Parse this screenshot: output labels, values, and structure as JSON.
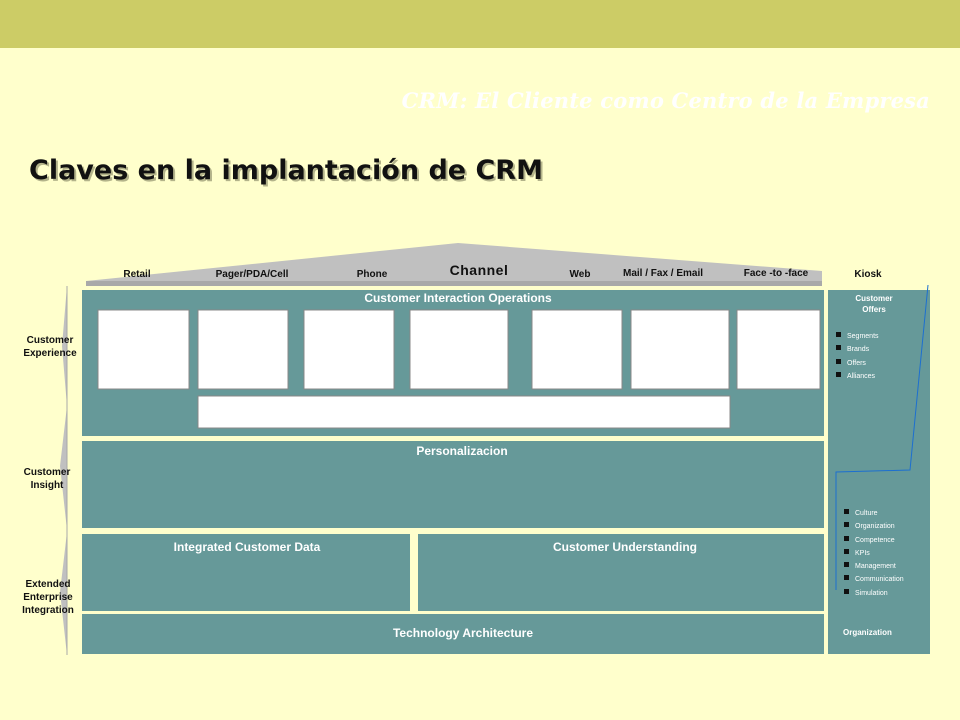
{
  "header": {
    "subtitle": "CRM: El Cliente como Centro de la Empresa",
    "title": "Claves en la implantación de CRM"
  },
  "channel": {
    "title": "Channel",
    "items": [
      "Retail",
      "Pager/PDA/Cell",
      "Phone",
      "Web",
      "Mail / Fax / Email",
      "Face -to -face",
      "Kiosk"
    ]
  },
  "layers": {
    "customer_experience": "Customer Experience",
    "customer_insight": "Customer Insight",
    "extended_integration": "Extended Enterprise Integration"
  },
  "panels": {
    "interaction": "Customer Interaction Operations",
    "personalization": "Personalizacion",
    "integrated_data": "Integrated Customer Data",
    "understanding": "Customer Understanding",
    "technology": "Technology Architecture"
  },
  "right_column": {
    "offers_title": "Customer Offers",
    "offers_items": [
      "Segments",
      "Brands",
      "Offers",
      "Alliances"
    ],
    "org_items": [
      "Culture",
      "Organization",
      "Competence",
      "KPIs",
      "Management",
      "Communication",
      "Simulation"
    ],
    "organization_label": "Organization"
  },
  "colors": {
    "background": "#FFFFCC",
    "top_bar": "#CCCC66",
    "panel": "#669999",
    "roof": "#C0C0C0",
    "white_box": "#FFFFFF"
  }
}
